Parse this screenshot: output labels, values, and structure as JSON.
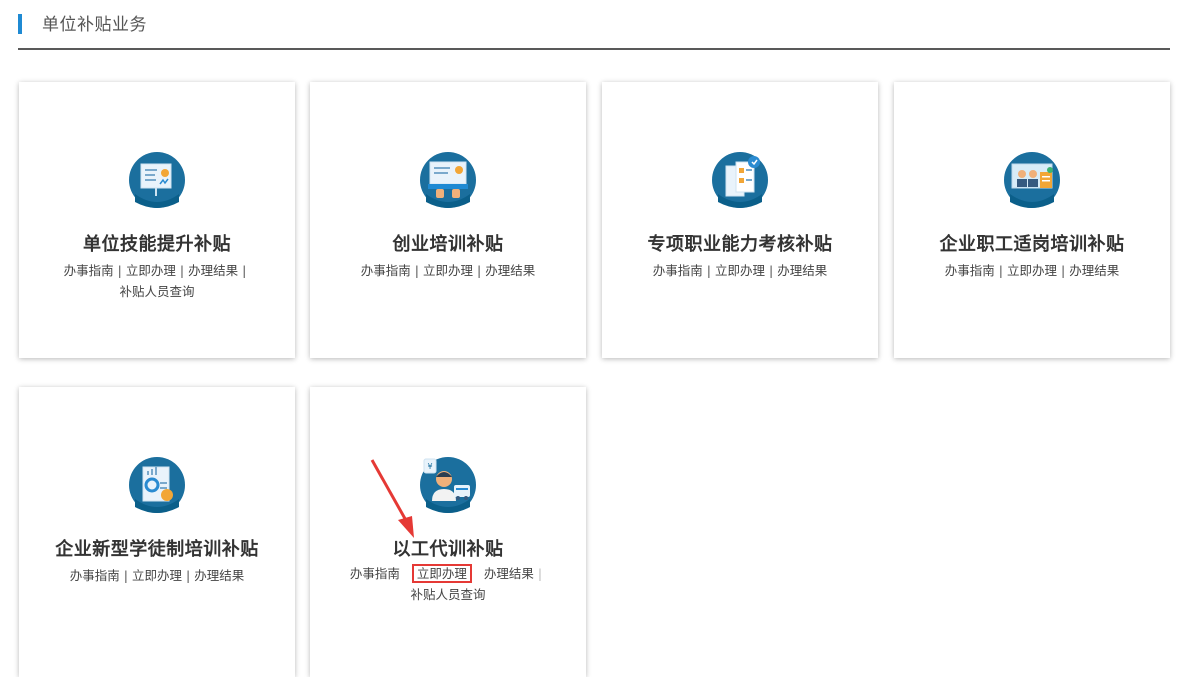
{
  "header": {
    "title": "单位补贴业务"
  },
  "cards": [
    {
      "name": "单位技能提升补贴",
      "links": [
        "办事指南",
        "立即办理",
        "办理结果",
        "补贴人员查询"
      ]
    },
    {
      "name": "创业培训补贴",
      "links": [
        "办事指南",
        "立即办理",
        "办理结果"
      ]
    },
    {
      "name": "专项职业能力考核补贴",
      "links": [
        "办事指南",
        "立即办理",
        "办理结果"
      ]
    },
    {
      "name": "企业职工适岗培训补贴",
      "links": [
        "办事指南",
        "立即办理",
        "办理结果"
      ]
    },
    {
      "name": "企业新型学徒制培训补贴",
      "links": [
        "办事指南",
        "立即办理",
        "办理结果"
      ]
    },
    {
      "name": "以工代训补贴",
      "links": [
        "办事指南",
        "立即办理",
        "办理结果",
        "补贴人员查询"
      ]
    }
  ],
  "colors": {
    "accent": "#1f8ad3",
    "icon_dark": "#0b5f8a",
    "highlight": "#e53935"
  },
  "icons": [
    "presentation-board-icon",
    "laptop-training-icon",
    "certificate-doc-icon",
    "team-meeting-icon",
    "growth-report-icon",
    "worker-icon"
  ]
}
